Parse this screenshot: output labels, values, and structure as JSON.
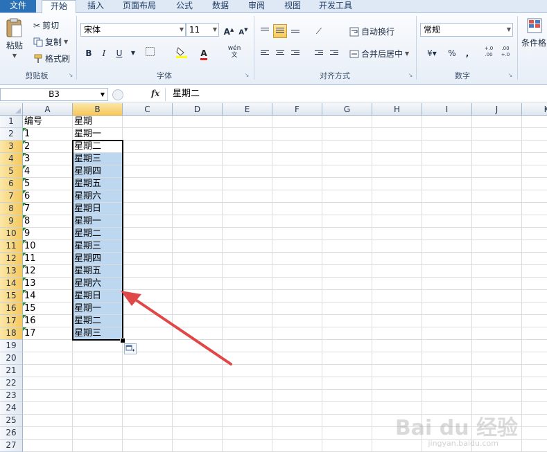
{
  "tabs": [
    {
      "label": "文件"
    },
    {
      "label": "开始"
    },
    {
      "label": "插入"
    },
    {
      "label": "页面布局"
    },
    {
      "label": "公式"
    },
    {
      "label": "数据"
    },
    {
      "label": "审阅"
    },
    {
      "label": "视图"
    },
    {
      "label": "开发工具"
    }
  ],
  "ribbon": {
    "clipboard": {
      "paste": "粘贴",
      "cut": "剪切",
      "copy": "复制",
      "format_painter": "格式刷",
      "group": "剪贴板"
    },
    "font": {
      "name": "宋体",
      "size": "11",
      "bold": "B",
      "italic": "I",
      "underline": "U",
      "group": "字体",
      "phonetic": "wén",
      "grow": "A",
      "shrink": "A",
      "color_a": "A"
    },
    "alignment": {
      "wrap": "自动换行",
      "merge": "合并后居中",
      "group": "对齐方式"
    },
    "number": {
      "format": "常规",
      "percent": "%",
      "comma": ",",
      "inc": "+.0 .00",
      "dec": ".00 +.0",
      "group": "数字"
    },
    "styles": {
      "conditional": "条件格"
    }
  },
  "formula_bar": {
    "name_box": "B3",
    "fx": "fx",
    "content": "星期二"
  },
  "columns": [
    "A",
    "B",
    "C",
    "D",
    "E",
    "F",
    "G",
    "H",
    "I",
    "J",
    "K"
  ],
  "rows": [
    {
      "n": "1",
      "a": "编号",
      "b": "星期"
    },
    {
      "n": "2",
      "a": "1",
      "b": "星期一"
    },
    {
      "n": "3",
      "a": "2",
      "b": "星期二"
    },
    {
      "n": "4",
      "a": "3",
      "b": "星期三"
    },
    {
      "n": "5",
      "a": "4",
      "b": "星期四"
    },
    {
      "n": "6",
      "a": "5",
      "b": "星期五"
    },
    {
      "n": "7",
      "a": "6",
      "b": "星期六"
    },
    {
      "n": "8",
      "a": "7",
      "b": "星期日"
    },
    {
      "n": "9",
      "a": "8",
      "b": "星期一"
    },
    {
      "n": "10",
      "a": "9",
      "b": "星期二"
    },
    {
      "n": "11",
      "a": "10",
      "b": "星期三"
    },
    {
      "n": "12",
      "a": "11",
      "b": "星期四"
    },
    {
      "n": "13",
      "a": "12",
      "b": "星期五"
    },
    {
      "n": "14",
      "a": "13",
      "b": "星期六"
    },
    {
      "n": "15",
      "a": "14",
      "b": "星期日"
    },
    {
      "n": "16",
      "a": "15",
      "b": "星期一"
    },
    {
      "n": "17",
      "a": "16",
      "b": "星期二"
    },
    {
      "n": "18",
      "a": "17",
      "b": "星期三"
    },
    {
      "n": "19",
      "a": "",
      "b": ""
    },
    {
      "n": "20",
      "a": "",
      "b": ""
    },
    {
      "n": "21",
      "a": "",
      "b": ""
    },
    {
      "n": "22",
      "a": "",
      "b": ""
    },
    {
      "n": "23",
      "a": "",
      "b": ""
    },
    {
      "n": "24",
      "a": "",
      "b": ""
    },
    {
      "n": "25",
      "a": "",
      "b": ""
    },
    {
      "n": "26",
      "a": "",
      "b": ""
    },
    {
      "n": "27",
      "a": "",
      "b": ""
    }
  ],
  "selection": {
    "range": "B3:B18"
  },
  "colors": {
    "accent": "#2b71b8",
    "selection_fill": "#bdd7f0",
    "arrow": "#e04848"
  },
  "watermark": {
    "text": "Bai du 经验",
    "sub": "jingyan.baidu.com"
  }
}
